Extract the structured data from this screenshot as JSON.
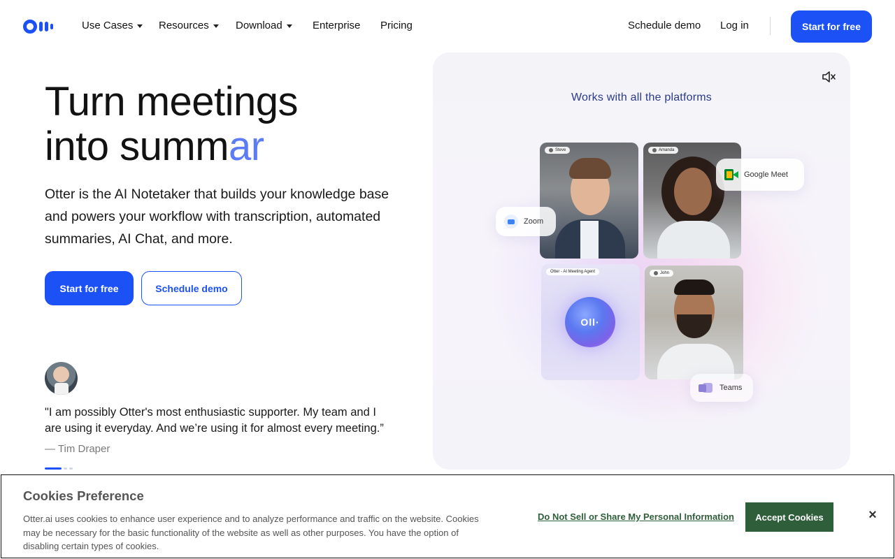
{
  "nav": {
    "items": [
      {
        "label": "Use Cases",
        "has_caret": true
      },
      {
        "label": "Resources",
        "has_caret": true
      },
      {
        "label": "Download",
        "has_caret": true
      },
      {
        "label": "Enterprise",
        "has_caret": false
      },
      {
        "label": "Pricing",
        "has_caret": false
      }
    ],
    "schedule_demo": "Schedule demo",
    "log_in": "Log in",
    "start_free": "Start for free"
  },
  "hero": {
    "headline_line1": "Turn meetings",
    "headline_line2_main": "into summ",
    "headline_line2_accent": "ar",
    "subtext": "Otter is the AI Notetaker that builds your knowledge base and powers your workflow with transcription, automated summaries, AI Chat, and more.",
    "cta_primary": "Start for free",
    "cta_secondary": "Schedule demo",
    "quote": "\"I am possibly Otter's most enthusiastic supporter. My team and I are using it everyday. And we’re using it for almost every meeting.”",
    "quote_author": "— Tim Draper"
  },
  "showcase": {
    "title": "Works with all the platforms",
    "participants": [
      "Steve",
      "Amanda",
      "Otter - AI Meeting Agent",
      "John"
    ],
    "platforms": [
      "Zoom",
      "Google Meet",
      "Teams"
    ],
    "brand_color": "#1c52f5"
  },
  "cookie": {
    "title": "Cookies Preference",
    "text": "Otter.ai uses cookies to enhance user experience and to analyze performance and traffic on the website. Cookies may be necessary for the basic functionality of the website as well as other purposes. You have the option of disabling certain types of cookies.",
    "do_not_sell": "Do Not Sell or Share My Personal Information",
    "accept": "Accept Cookies",
    "close_icon": "×",
    "accent_color": "#2f5e3a"
  }
}
